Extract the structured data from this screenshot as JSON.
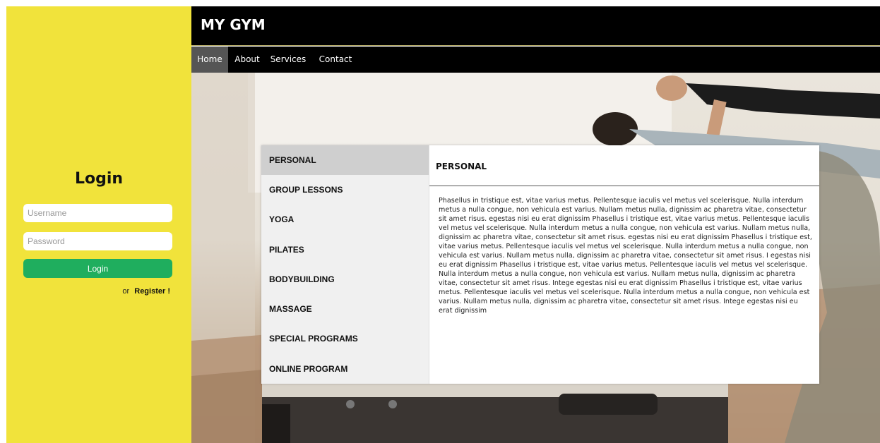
{
  "brand": "MY GYM",
  "nav": {
    "items": [
      "Home",
      "About",
      "Services",
      "Contact"
    ],
    "active": "Home"
  },
  "login": {
    "title": "Login",
    "username_placeholder": "Username",
    "password_placeholder": "Password",
    "button_label": "Login",
    "register_prefix": "or",
    "register_label": "Register !"
  },
  "tabs": {
    "items": [
      "PERSONAL",
      "GROUP LESSONS",
      "YOGA",
      "PILATES",
      "BODYBUILDING",
      "MASSAGE",
      "SPECIAL PROGRAMS",
      "ONLINE PROGRAM"
    ],
    "active": "PERSONAL"
  },
  "content": {
    "title": "PERSONAL",
    "body": "Phasellus in tristique est, vitae varius metus. Pellentesque iaculis vel metus vel scelerisque. Nulla interdum metus a nulla congue, non vehicula est varius. Nullam metus nulla, dignissim ac pharetra vitae, consectetur sit amet risus. egestas nisi eu erat dignissim Phasellus i tristique est, vitae varius metus. Pellentesque iaculis vel metus vel scelerisque. Nulla interdum metus a nulla congue, non vehicula est varius. Nullam metus nulla, dignissim ac pharetra vitae, consectetur sit amet risus. egestas nisi eu erat dignissim Phasellus i tristique est, vitae varius metus. Pellentesque iaculis vel metus vel scelerisque. Nulla interdum metus a nulla congue, non vehicula est varius. Nullam metus nulla, dignissim ac pharetra vitae, consectetur sit amet risus. I egestas nisi eu erat dignissim Phasellus i tristique est, vitae varius metus. Pellentesque iaculis vel metus vel scelerisque. Nulla interdum metus a nulla congue, non vehicula est varius. Nullam metus nulla, dignissim ac pharetra vitae, consectetur sit amet risus. Intege egestas nisi eu erat dignissim Phasellus i tristique est, vitae varius metus. Pellentesque iaculis vel metus vel scelerisque. Nulla interdum metus a nulla congue, non vehicula est varius. Nullam metus nulla, dignissim ac pharetra vitae, consectetur sit amet risus. Intege egestas nisi eu erat dignissim"
  },
  "colors": {
    "sidebar_bg": "#f1e33b",
    "login_button": "#1fae5e",
    "header_bg": "#000000",
    "nav_active_bg": "#555555",
    "tab_active_bg": "#cfcfcf"
  }
}
